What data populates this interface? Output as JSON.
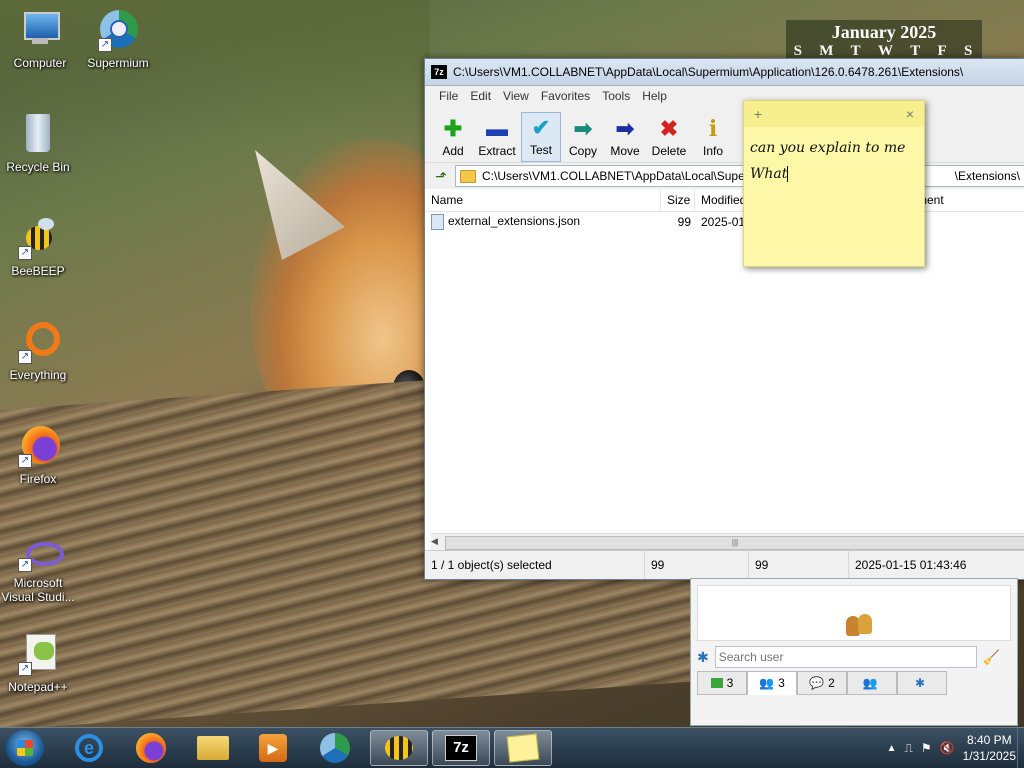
{
  "desktop": {
    "icons": [
      {
        "label": "Computer"
      },
      {
        "label": "Supermium"
      },
      {
        "label": "Recycle Bin"
      },
      {
        "label": "BeeBEEP"
      },
      {
        "label": "Everything"
      },
      {
        "label": "Firefox"
      },
      {
        "label": "Microsoft Visual Studi..."
      },
      {
        "label": "Notepad++"
      }
    ]
  },
  "calendar": {
    "month": "January 2025",
    "days": [
      "S",
      "M",
      "T",
      "W",
      "T",
      "F",
      "S"
    ]
  },
  "sevenzip": {
    "title": "C:\\Users\\VM1.COLLABNET\\AppData\\Local\\Supermium\\Application\\126.0.6478.261\\Extensions\\",
    "menu": [
      "File",
      "Edit",
      "View",
      "Favorites",
      "Tools",
      "Help"
    ],
    "toolbar": [
      {
        "label": "Add",
        "icon": "add-icon",
        "color": "#1aa31a",
        "glyph": "✚"
      },
      {
        "label": "Extract",
        "icon": "extract-icon",
        "color": "#1c3fb8",
        "glyph": "▬"
      },
      {
        "label": "Test",
        "icon": "test-icon",
        "color": "#1aa0c8",
        "glyph": "✔"
      },
      {
        "label": "Copy",
        "icon": "copy-icon",
        "color": "#1b8a7a",
        "glyph": "➡"
      },
      {
        "label": "Move",
        "icon": "move-icon",
        "color": "#1c2fa0",
        "glyph": "➡"
      },
      {
        "label": "Delete",
        "icon": "delete-icon",
        "color": "#d42020",
        "glyph": "✖"
      },
      {
        "label": "Info",
        "icon": "info-icon",
        "color": "#c89a10",
        "glyph": "i"
      }
    ],
    "address": "C:\\Users\\VM1.COLLABNET\\AppData\\Local\\Supe",
    "address_tail": "\\Extensions\\",
    "columns": {
      "name": "Name",
      "size": "Size",
      "modified": "Modified",
      "comment": "ment"
    },
    "rows": [
      {
        "name": "external_extensions.json",
        "size": "99",
        "modified": "2025-01-"
      }
    ],
    "status": {
      "selected": "1 / 1 object(s) selected",
      "size": "99",
      "packed": "99",
      "date": "2025-01-15 01:43:46"
    }
  },
  "sticky": {
    "add": "+",
    "close": "×",
    "line1": "can you explain to me",
    "line2": "What"
  },
  "beebeep": {
    "search_placeholder": "Search user",
    "tabs": [
      {
        "count": "3"
      },
      {
        "count": "3"
      },
      {
        "count": "2"
      },
      {
        "count": ""
      },
      {
        "count": ""
      }
    ]
  },
  "taskbar": {
    "time": "8:40 PM",
    "date": "1/31/2025"
  }
}
